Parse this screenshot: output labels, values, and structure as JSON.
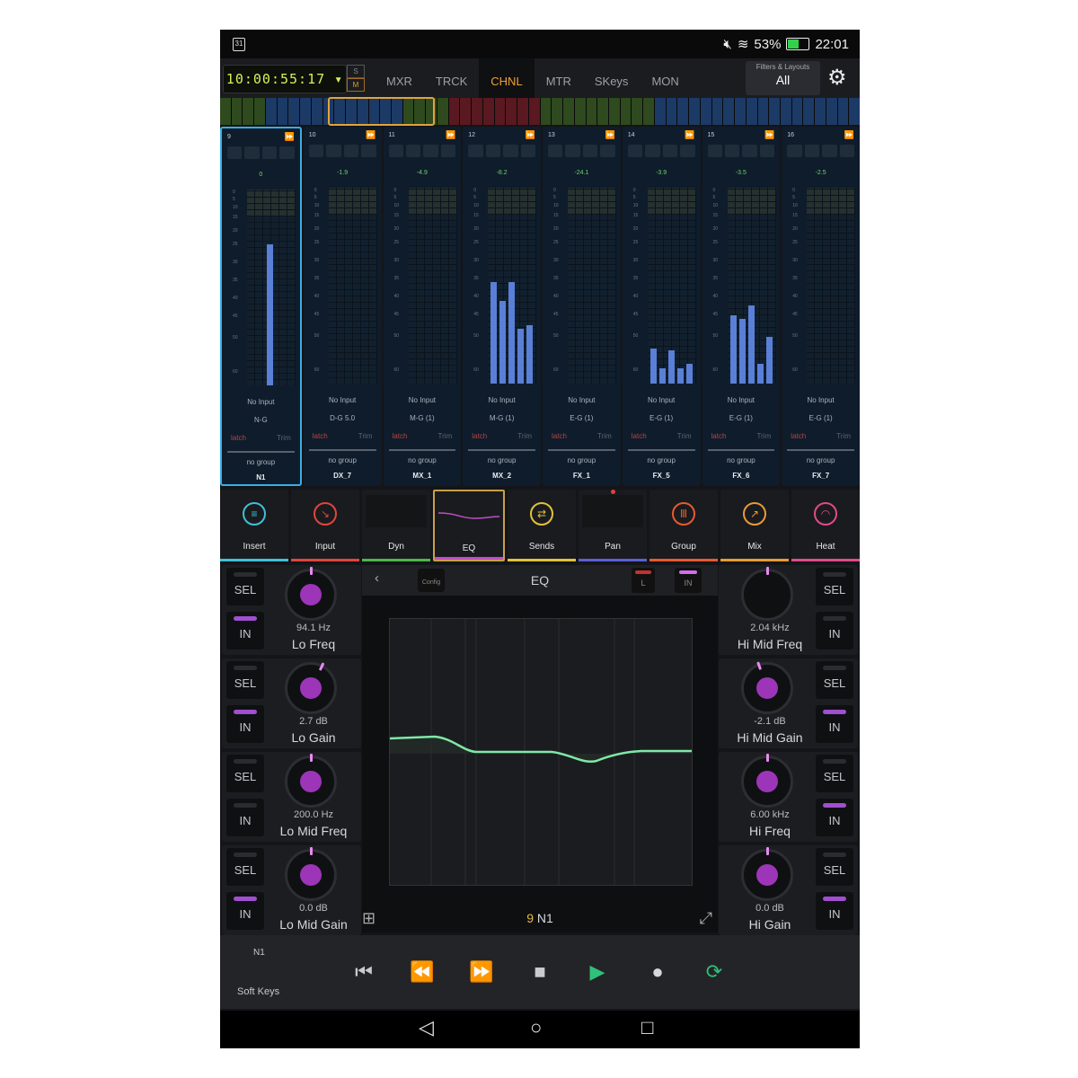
{
  "status": {
    "time": "22:01",
    "battery_pct": "53%",
    "battery_level": 0.53,
    "calendar_day": "31"
  },
  "header": {
    "timecode": "10:00:55:17",
    "s_label": "S",
    "m_label": "M",
    "tabs": [
      "MXR",
      "TRCK",
      "CHNL",
      "MTR",
      "SKeys",
      "MON"
    ],
    "active_tab": "CHNL",
    "filters_caption": "Filters & Layouts",
    "filters_value": "All"
  },
  "overview_colors": [
    "#2e4a1e",
    "#2e4a1e",
    "#2e4a1e",
    "#2e4a1e",
    "#1c3a66",
    "#1c3a66",
    "#1c3a66",
    "#1c3a66",
    "#1c3a66",
    "#1c3a66",
    "#1c3a66",
    "#1c3a66",
    "#1c3a66",
    "#1c3a66",
    "#1c3a66",
    "#1c3a66",
    "#2e4a1e",
    "#2e4a1e",
    "#2e4a1e",
    "#2e4a1e",
    "#5a1820",
    "#5a1820",
    "#5a1820",
    "#5a1820",
    "#5a1820",
    "#5a1820",
    "#5a1820",
    "#5a1820",
    "#2e4a1e",
    "#2e4a1e",
    "#2e4a1e",
    "#2e4a1e",
    "#2e4a1e",
    "#2e4a1e",
    "#2e4a1e",
    "#2e4a1e",
    "#2e4a1e",
    "#2e4a1e",
    "#1c3a66",
    "#1c3a66",
    "#1c3a66",
    "#1c3a66",
    "#1c3a66",
    "#1c3a66",
    "#1c3a66",
    "#1c3a66",
    "#1c3a66",
    "#1c3a66",
    "#1c3a66",
    "#1c3a66",
    "#1c3a66",
    "#1c3a66",
    "#1c3a66",
    "#1c3a66",
    "#1c3a66",
    "#1c3a66"
  ],
  "channels": [
    {
      "num": "9",
      "value": "0",
      "input": "No Input",
      "routing": "N-G",
      "latch": "latch",
      "trim": "Trim",
      "group": "no group",
      "name": "N1",
      "selected": true,
      "levels": [
        0.72
      ]
    },
    {
      "num": "10",
      "value": "-1.9",
      "input": "No Input",
      "routing": "D-G 5.0",
      "latch": "latch",
      "trim": "Trim",
      "group": "no group",
      "name": "DX_7",
      "selected": false,
      "levels": []
    },
    {
      "num": "11",
      "value": "-4.9",
      "input": "No Input",
      "routing": "M-G (1)",
      "latch": "latch",
      "trim": "Trim",
      "group": "no group",
      "name": "MX_1",
      "selected": false,
      "levels": []
    },
    {
      "num": "12",
      "value": "-8.2",
      "input": "No Input",
      "routing": "M-G (1)",
      "latch": "latch",
      "trim": "Trim",
      "group": "no group",
      "name": "MX_2",
      "selected": false,
      "levels": [
        0.52,
        0.42,
        0.52,
        0.28,
        0.3
      ]
    },
    {
      "num": "13",
      "value": "-24.1",
      "input": "No Input",
      "routing": "E-G (1)",
      "latch": "latch",
      "trim": "Trim",
      "group": "no group",
      "name": "FX_1",
      "selected": false,
      "levels": []
    },
    {
      "num": "14",
      "value": "-3.9",
      "input": "No Input",
      "routing": "E-G (1)",
      "latch": "latch",
      "trim": "Trim",
      "group": "no group",
      "name": "FX_5",
      "selected": false,
      "levels": [
        0.18,
        0.08,
        0.17,
        0.08,
        0.1
      ]
    },
    {
      "num": "15",
      "value": "-3.5",
      "input": "No Input",
      "routing": "E-G (1)",
      "latch": "latch",
      "trim": "Trim",
      "group": "no group",
      "name": "FX_6",
      "selected": false,
      "levels": [
        0.35,
        0.33,
        0.4,
        0.1,
        0.24
      ]
    },
    {
      "num": "16",
      "value": "-2.5",
      "input": "No Input",
      "routing": "E-G (1)",
      "latch": "latch",
      "trim": "Trim",
      "group": "no group",
      "name": "FX_7",
      "selected": false,
      "levels": []
    }
  ],
  "meter_scale": [
    "0",
    "5",
    "10",
    "15",
    "20",
    "25",
    "30",
    "35",
    "40",
    "45",
    "50",
    "60"
  ],
  "function_tabs": [
    {
      "label": "Insert",
      "color": "#3fc0d8",
      "icon": "list-icon",
      "glyph": "≡"
    },
    {
      "label": "Input",
      "color": "#e0453d",
      "icon": "input-arrow-icon",
      "glyph": "↘"
    },
    {
      "label": "Dyn",
      "color": "#4bb84b",
      "icon": "dynamics-graph-icon",
      "glyph": ""
    },
    {
      "label": "EQ",
      "color": "#c04ec8",
      "icon": "eq-curve-icon",
      "glyph": ""
    },
    {
      "label": "Sends",
      "color": "#e1c23a",
      "icon": "sends-icon",
      "glyph": "⇄"
    },
    {
      "label": "Pan",
      "color": "#5a5fd6",
      "icon": "pan-icon",
      "glyph": ""
    },
    {
      "label": "Group",
      "color": "#e85a2f",
      "icon": "group-icon",
      "glyph": "Ⅲ"
    },
    {
      "label": "Mix",
      "color": "#e89a38",
      "icon": "mix-icon",
      "glyph": "↗"
    },
    {
      "label": "Heat",
      "color": "#e04a8a",
      "icon": "heat-gauge-icon",
      "glyph": "◠"
    }
  ],
  "selected_function": "EQ",
  "sel_label": "SEL",
  "in_label": "IN",
  "knobs_left": [
    {
      "value": "94.1 Hz",
      "name": "Lo Freq",
      "in_on": true
    },
    {
      "value": "2.7 dB",
      "name": "Lo Gain",
      "in_on": true
    },
    {
      "value": "200.0 Hz",
      "name": "Lo Mid Freq",
      "in_on": false
    },
    {
      "value": "0.0 dB",
      "name": "Lo Mid Gain",
      "in_on": true
    }
  ],
  "knobs_right": [
    {
      "value": "2.04 kHz",
      "name": "Hi Mid Freq",
      "in_on": false
    },
    {
      "value": "-2.1 dB",
      "name": "Hi Mid Gain",
      "in_on": true
    },
    {
      "value": "6.00 kHz",
      "name": "Hi Freq",
      "in_on": true
    },
    {
      "value": "0.0 dB",
      "name": "Hi Gain",
      "in_on": true
    }
  ],
  "eq": {
    "title": "EQ",
    "config_label": "Config",
    "l_label": "L",
    "in_label": "IN",
    "channel_num": "9",
    "channel_name": "N1",
    "curve_color": "#7fe8a6"
  },
  "transport": {
    "channel": "N1",
    "soft_keys": "Soft Keys"
  }
}
